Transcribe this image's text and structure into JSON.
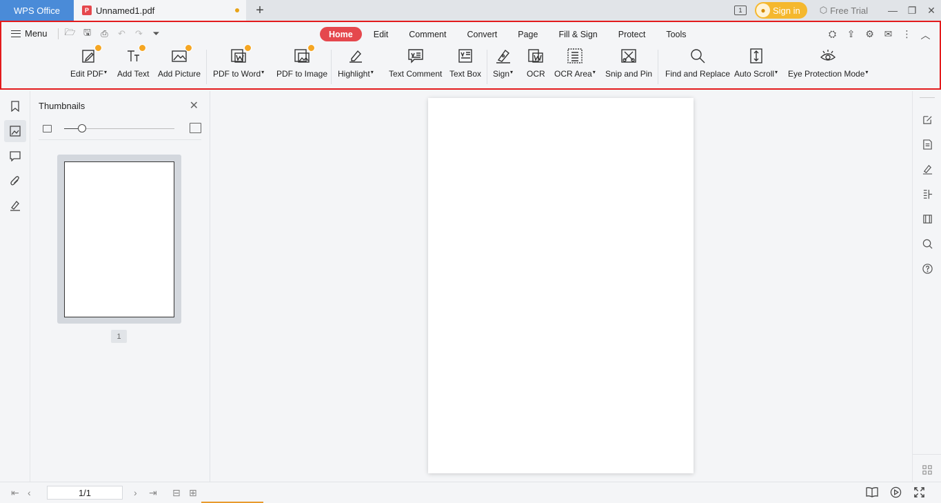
{
  "titlebar": {
    "app_tab": "WPS Office",
    "doc_tab": "Unnamed1.pdf",
    "new_tab": "+",
    "page_indicator": "1",
    "signin": "Sign in",
    "free_trial": "Free Trial"
  },
  "ribbon": {
    "menu_label": "Menu",
    "tabs": [
      "Home",
      "Edit",
      "Comment",
      "Convert",
      "Page",
      "Fill & Sign",
      "Protect",
      "Tools"
    ],
    "active_tab": "Home",
    "tools": [
      {
        "label": "Edit PDF",
        "icon": "edit-pdf-icon",
        "dropdown": true,
        "premium": true
      },
      {
        "label": "Add Text",
        "icon": "add-text-icon",
        "dropdown": false,
        "premium": true
      },
      {
        "label": "Add Picture",
        "icon": "add-picture-icon",
        "dropdown": false,
        "premium": true
      },
      {
        "label": "PDF to Word",
        "icon": "pdf-to-word-icon",
        "dropdown": true,
        "premium": true
      },
      {
        "label": "PDF to Image",
        "icon": "pdf-to-image-icon",
        "dropdown": false,
        "premium": true
      },
      {
        "label": "Highlight",
        "icon": "highlight-icon",
        "dropdown": true,
        "premium": false
      },
      {
        "label": "Text Comment",
        "icon": "text-comment-icon",
        "dropdown": false,
        "premium": false
      },
      {
        "label": "Text Box",
        "icon": "text-box-icon",
        "dropdown": false,
        "premium": false
      },
      {
        "label": "Sign",
        "icon": "sign-icon",
        "dropdown": true,
        "premium": false
      },
      {
        "label": "OCR",
        "icon": "ocr-icon",
        "dropdown": false,
        "premium": false
      },
      {
        "label": "OCR Area",
        "icon": "ocr-area-icon",
        "dropdown": true,
        "premium": false
      },
      {
        "label": "Snip and Pin",
        "icon": "snip-pin-icon",
        "dropdown": false,
        "premium": false
      },
      {
        "label": "Find and Replace",
        "icon": "find-replace-icon",
        "dropdown": false,
        "premium": false
      },
      {
        "label": "Auto Scroll",
        "icon": "auto-scroll-icon",
        "dropdown": true,
        "premium": false
      },
      {
        "label": "Eye Protection Mode",
        "icon": "eye-protection-icon",
        "dropdown": true,
        "premium": false
      }
    ]
  },
  "thumbnails": {
    "title": "Thumbnails",
    "page_number": "1"
  },
  "status": {
    "page_field": "1/1"
  },
  "colors": {
    "accent": "#e5484d",
    "app_tab": "#4a8bd8",
    "signin": "#f5b82e",
    "highlight_border": "#e31a1c"
  }
}
